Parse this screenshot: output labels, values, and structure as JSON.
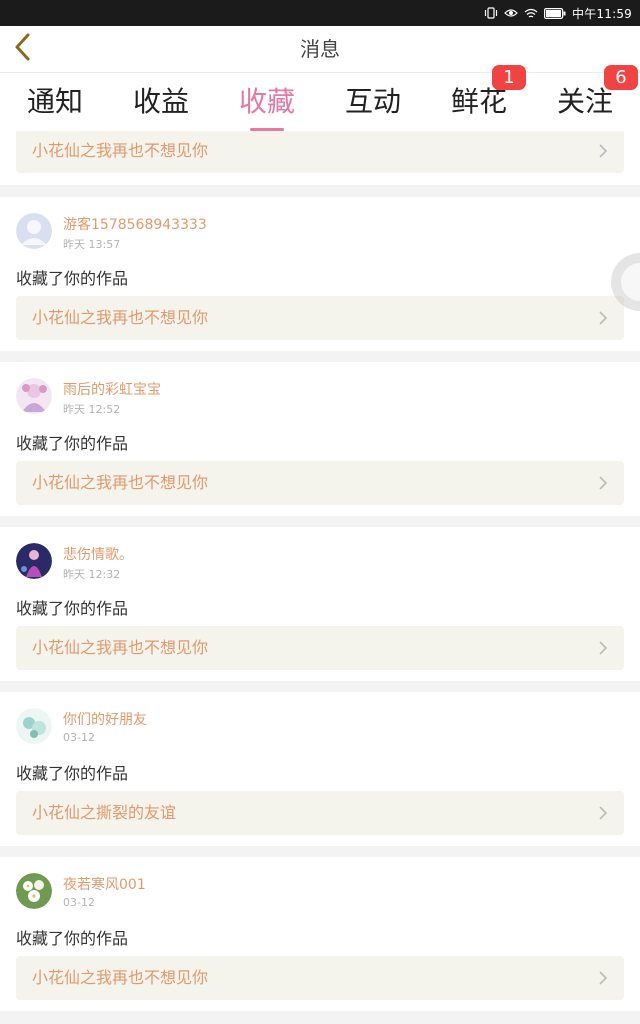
{
  "status_bar": {
    "time": "中午11:59",
    "icons": [
      "vibrate-icon",
      "eye-comfort-icon",
      "wifi-icon",
      "battery-icon"
    ]
  },
  "navbar": {
    "title": "消息",
    "back_icon": "chevron-left-icon"
  },
  "tabs": [
    {
      "label": "通知",
      "badge": null,
      "active": false
    },
    {
      "label": "收益",
      "badge": null,
      "active": false
    },
    {
      "label": "收藏",
      "badge": null,
      "active": true
    },
    {
      "label": "互动",
      "badge": null,
      "active": false
    },
    {
      "label": "鲜花",
      "badge": "1",
      "active": false
    },
    {
      "label": "关注",
      "badge": "6",
      "active": false
    }
  ],
  "top_partial": {
    "work_title": "小花仙之我再也不想见你"
  },
  "notifications": [
    {
      "username": "游客1578568943333",
      "time": "昨天 13:57",
      "action": "收藏了你的作品",
      "work_title": "小花仙之我再也不想见你",
      "avatar": "default-avatar"
    },
    {
      "username": "雨后的彩虹宝宝",
      "time": "昨天 12:52",
      "action": "收藏了你的作品",
      "work_title": "小花仙之我再也不想见你",
      "avatar": "anime-girl-avatar"
    },
    {
      "username": "悲伤情歌。",
      "time": "昨天 12:32",
      "action": "收藏了你的作品",
      "work_title": "小花仙之我再也不想见你",
      "avatar": "purple-figure-avatar"
    },
    {
      "username": "你们的好朋友",
      "time": "03-12",
      "action": "收藏了你的作品",
      "work_title": "小花仙之撕裂的友谊",
      "avatar": "flower-sketch-avatar"
    },
    {
      "username": "夜若寒风001",
      "time": "03-12",
      "action": "收藏了你的作品",
      "work_title": "小花仙之我再也不想见你",
      "avatar": "white-flowers-avatar"
    }
  ],
  "colors": {
    "accent": "#e47aa2",
    "username": "#e29a6c",
    "badge": "#f04444",
    "link_bg": "#f4f3ec"
  }
}
